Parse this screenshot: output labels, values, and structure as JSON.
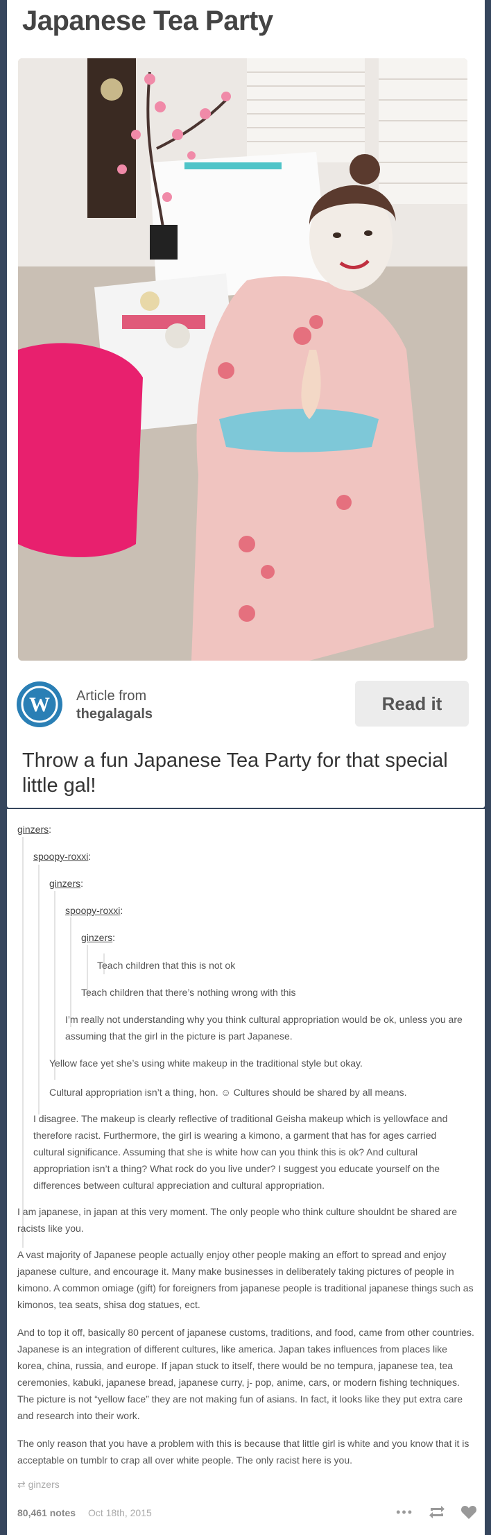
{
  "card": {
    "title": "Japanese Tea Party",
    "article_from": "Article from",
    "source": "thegalagals",
    "read_label": "Read it",
    "tagline": "Throw a fun Japanese Tea Party for that special little gal!"
  },
  "thread": [
    {
      "user": "ginzers",
      "text": "Teach children that this is not ok"
    },
    {
      "user": "spoopy-roxxi",
      "text": "Teach children that there’s nothing wrong with this"
    },
    {
      "user": "ginzers",
      "text": "I’m really not understanding why you think cultural appropriation would be ok, unless you are assuming that the girl in the picture is part Japanese."
    },
    {
      "user": "spoopy-roxxi",
      "text": "Yellow face yet she’s using white makeup in the traditional style but okay."
    },
    {
      "user": "ginzers",
      "text": "Cultural appropriation isn’t a thing, hon. ☺ Cultures should be shared by all means."
    },
    {
      "user": "ginzers",
      "text": "I disagree. The makeup is clearly reflective of traditional Geisha makeup which is yellowface and therefore racist. Furthermore, the girl is wearing a kimono, a garment that has for ages carried cultural significance. Assuming that she is white how can you think this is ok? And cultural appropriation isn’t a thing? What rock do you live under? I suggest you educate yourself on the differences between cultural appreciation and cultural appropriation."
    }
  ],
  "reply": {
    "p1": "I am japanese, in japan at this very moment. The only people who think culture shouldnt be shared are racists like you.",
    "p2": "A vast majority of Japanese people actually enjoy other people making an effort to spread and enjoy japanese culture, and encourage it. Many make businesses in deliberately taking pictures of people in kimono. A common omiage (gift) for foreigners from japanese people is traditional japanese things such as kimonos, tea seats, shisa dog statues, ect.",
    "p3": "And to top it off, basically 80 percent of japanese customs, traditions, and food, came from other countries. Japanese is an integration of different cultures, like america. Japan takes influences from places like korea, china, russia, and europe. If japan stuck to itself, there would be no tempura, japanese tea, tea ceremonies, kabuki, japanese bread, japanese curry, j- pop, anime, cars, or modern fishing techniques. The picture is not “yellow face” they are not making fun of asians. In fact, it looks like they put extra care and research into their work.",
    "p4": "The only reason that you have a problem with this is because that little girl is white and you know that it is acceptable on tumblr to crap all over white people. The only racist here is you."
  },
  "footer": {
    "reblogged_from": "ginzers",
    "notes": "80,461 notes",
    "date": "Oct 18th, 2015"
  },
  "colors": {
    "background": "#36465d",
    "wordpress_blue": "#2a7fb5",
    "kimono_pink": "#f0c4c0",
    "cushion_pink": "#e8206e"
  },
  "icons": [
    "wordpress-logo",
    "reblog-icon",
    "more-icon",
    "heart-icon"
  ]
}
